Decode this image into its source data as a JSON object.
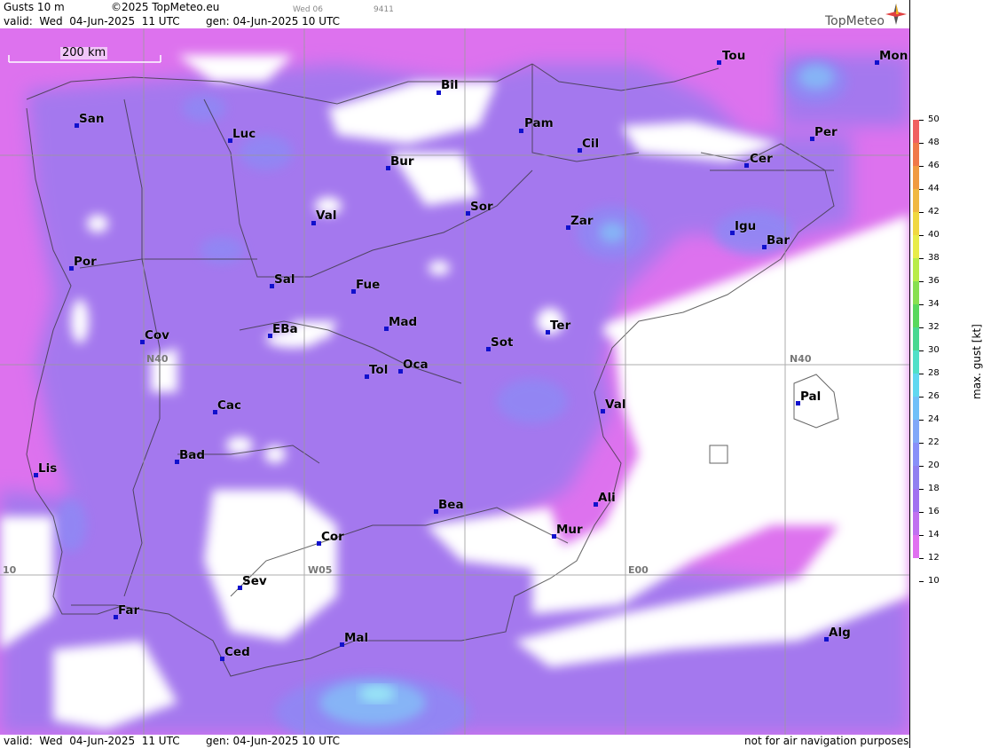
{
  "header": {
    "title": "Gusts 10 m",
    "copyright": "©2025 TopMeteo.eu",
    "tab_day": "Wed 06",
    "tab_code": "9411",
    "valid": "valid:  Wed  04-Jun-2025  11 UTC",
    "gen": "gen: 04-Jun-2025 10 UTC",
    "logo": "TopMeteo"
  },
  "footer": {
    "valid": "valid:  Wed  04-Jun-2025  11 UTC",
    "gen": "gen: 04-Jun-2025 10 UTC",
    "note": "not for air navigation purposes"
  },
  "map": {
    "scale": "200 km",
    "grid_labels": {
      "n40_left": "N40",
      "n40_right": "N40",
      "w05": "W05",
      "e00": "E00",
      "w10": "10"
    },
    "cities": [
      "Tou",
      "Mon",
      "Bil",
      "San",
      "Pam",
      "Luc",
      "Cil",
      "Per",
      "Bur",
      "Cer",
      "Sor",
      "Val",
      "Zar",
      "Igu",
      "Bar",
      "Por",
      "Sal",
      "Fue",
      "Mad",
      "Ter",
      "Cov",
      "EBa",
      "Sot",
      "Tol",
      "Oca",
      "Val",
      "Pal",
      "Cac",
      "Bad",
      "Lis",
      "Ali",
      "Bea",
      "Mur",
      "Cor",
      "Sev",
      "Far",
      "Alg",
      "Mal",
      "Ced"
    ]
  },
  "legend": {
    "label": "max. gust [kt]",
    "ticks": [
      "50",
      "48",
      "46",
      "44",
      "42",
      "40",
      "38",
      "36",
      "34",
      "32",
      "30",
      "28",
      "26",
      "24",
      "22",
      "20",
      "18",
      "16",
      "14",
      "12",
      "10"
    ],
    "colors": [
      "#f06060",
      "#f07848",
      "#f09a40",
      "#f0b840",
      "#f0d840",
      "#e8ec48",
      "#b8ec48",
      "#88e050",
      "#58d85c",
      "#48d890",
      "#50e0c8",
      "#60d8f0",
      "#70c0f8",
      "#80a8f8",
      "#8890f8",
      "#9080f0",
      "#a070f0",
      "#c070f0",
      "#e070f0"
    ]
  }
}
